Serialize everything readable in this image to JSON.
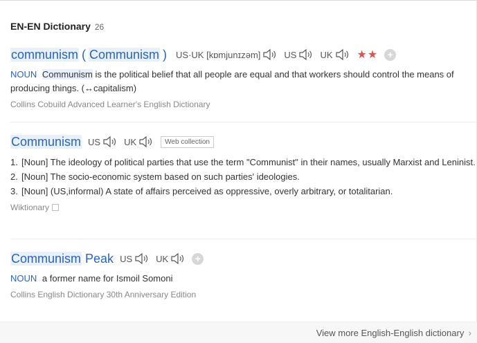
{
  "header": {
    "title": "EN-EN Dictionary",
    "count": "26"
  },
  "entry1": {
    "headword": "communism",
    "paren_open": "(",
    "alt_form": "Communism",
    "paren_close": ")",
    "pron_ipa_label": "US·UK [kɒmjunɪzəm]",
    "us_label": "US",
    "uk_label": "UK",
    "stars": "★★",
    "pos": "NOUN",
    "def_word": "Communism",
    "def_rest": " is the political belief that all people are equal and that workers should control the means of producing things. (↔capitalism)",
    "source": "Collins Cobuild Advanced Learner's English Dictionary"
  },
  "entry2": {
    "headword": "Communism",
    "us_label": "US",
    "uk_label": "UK",
    "web_collection": "Web collection",
    "senses": [
      {
        "num": "1.",
        "text": "[Noun] The ideology of political parties that use the term \"Communist\" in their names, usually Marxist and Leninist."
      },
      {
        "num": "2.",
        "text": "[Noun] The socio-economic system based on such parties' ideologies."
      },
      {
        "num": "3.",
        "text": "[Noun] (US,informal) A state of affairs perceived as oppressive, overly arbitrary, or totalitarian."
      }
    ],
    "source": "Wiktionary"
  },
  "entry3": {
    "headword_word": "Communism",
    "headword_rest": "Peak",
    "us_label": "US",
    "uk_label": "UK",
    "pos": "NOUN",
    "definition": "a former name for Ismoil Somoni",
    "source": "Collins English Dictionary 30th Anniversary Edition"
  },
  "footer": {
    "more_label": "View more English-English dictionary",
    "chevron": "›"
  },
  "colors": {
    "link": "#2a63b8",
    "highlight": "#e8f1fb",
    "stars": "#d9534f"
  },
  "icons": {
    "speaker": "speaker-icon",
    "plus": "add-icon",
    "external": "external-box-icon"
  }
}
